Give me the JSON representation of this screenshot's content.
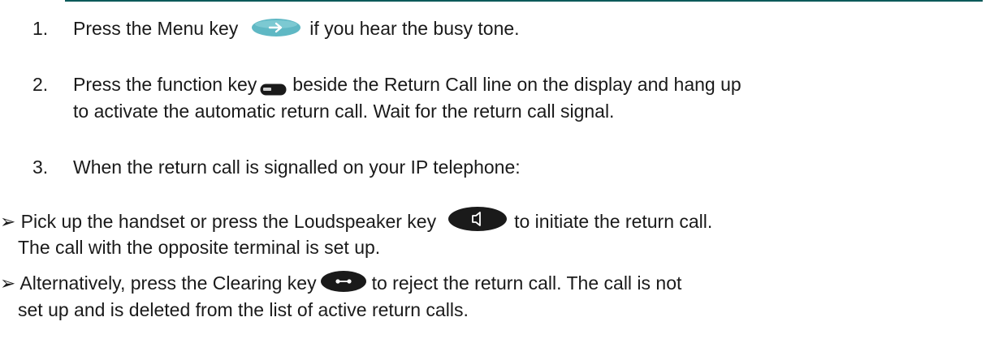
{
  "steps": [
    {
      "num": "1.",
      "before": "Press the Menu key",
      "after": "if you hear the busy tone.",
      "icon": "menu-key-icon"
    },
    {
      "num": "2.",
      "before": "Press the function key",
      "after": "beside the Return Call line on the display and hang up",
      "line2": "to activate the automatic return call. Wait for the return call signal.",
      "icon": "function-key-icon"
    },
    {
      "num": "3.",
      "text": "When the return call is signalled on your IP telephone:"
    }
  ],
  "bullets": [
    {
      "marker": "➢",
      "before": "Pick up the handset or press the Loudspeaker key",
      "after": "to initiate the return call.",
      "line2": "The call with the opposite terminal is set up.",
      "icon": "loudspeaker-key-icon"
    },
    {
      "marker": "➢",
      "before": "Alternatively, press the Clearing key",
      "after": "to reject the return call. The call is not",
      "line2": "set up and is deleted from the list of active return calls.",
      "icon": "clearing-key-icon"
    }
  ],
  "colors": {
    "rule": "#0c5a5a",
    "menu_key": "#5fb8c4",
    "key_dark": "#1a1a1a",
    "text": "#1a1a1a"
  }
}
